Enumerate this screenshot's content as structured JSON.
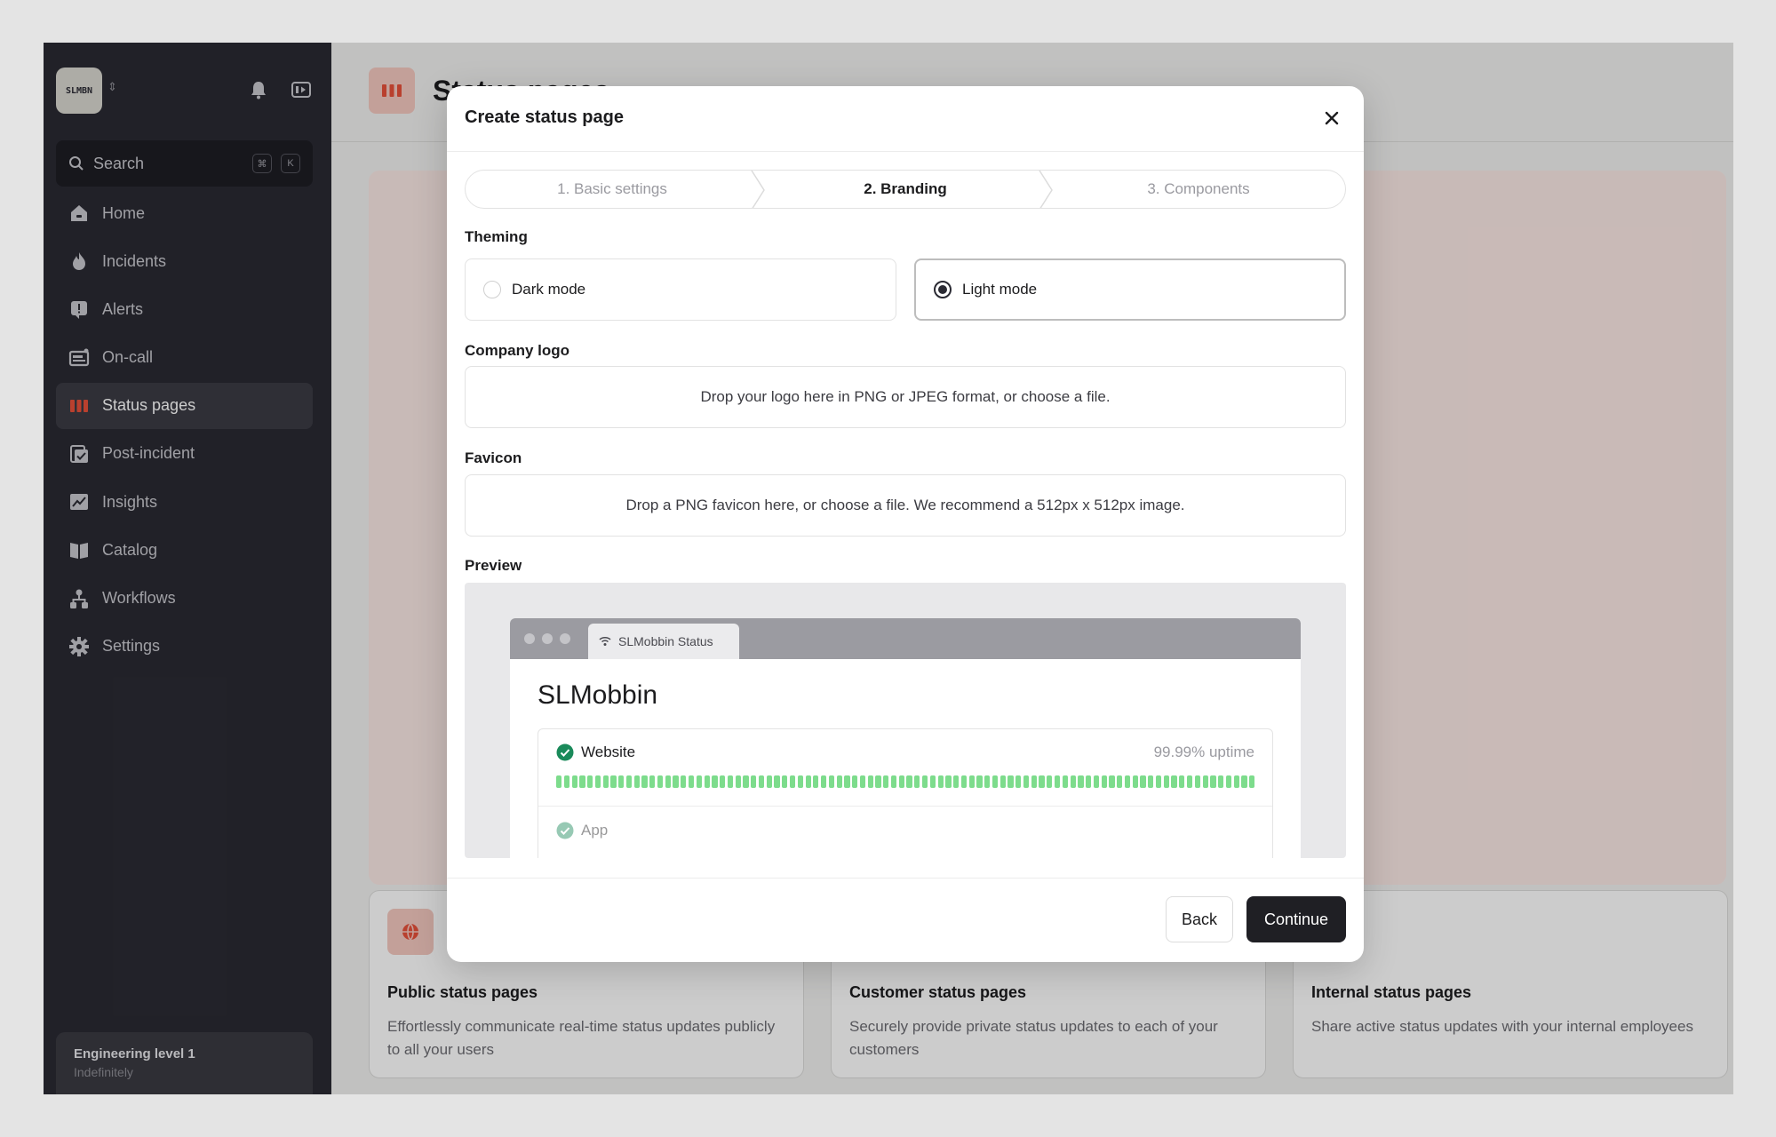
{
  "sidebar": {
    "logo_text": "SLMBN",
    "search": {
      "label": "Search",
      "shortcut_keys": [
        "⌘",
        "K"
      ]
    },
    "items": [
      {
        "label": "Home",
        "icon": "home-icon"
      },
      {
        "label": "Incidents",
        "icon": "flame-icon"
      },
      {
        "label": "Alerts",
        "icon": "alert-icon"
      },
      {
        "label": "On-call",
        "icon": "pager-icon"
      },
      {
        "label": "Status pages",
        "icon": "status-bars-icon",
        "active": true
      },
      {
        "label": "Post-incident",
        "icon": "clipboard-check-icon"
      },
      {
        "label": "Insights",
        "icon": "chart-icon"
      },
      {
        "label": "Catalog",
        "icon": "book-icon"
      },
      {
        "label": "Workflows",
        "icon": "workflow-icon"
      },
      {
        "label": "Settings",
        "icon": "gear-icon"
      }
    ],
    "footer": {
      "title": "Engineering level 1",
      "subtitle": "Indefinitely"
    }
  },
  "main": {
    "title": "Status pages",
    "cards": [
      {
        "title": "Public status pages",
        "description": "Effortlessly communicate real-time status updates publicly to all your users"
      },
      {
        "title": "Customer status pages",
        "description": "Securely provide private status updates to each of your customers"
      },
      {
        "title": "Internal status pages",
        "description": "Share active status updates with your internal employees"
      }
    ]
  },
  "modal": {
    "title": "Create status page",
    "steps": [
      {
        "label": "1. Basic settings",
        "current": false
      },
      {
        "label": "2. Branding",
        "current": true
      },
      {
        "label": "3. Components",
        "current": false
      }
    ],
    "theming": {
      "label": "Theming",
      "options": [
        {
          "label": "Dark mode",
          "selected": false
        },
        {
          "label": "Light mode",
          "selected": true
        }
      ]
    },
    "company_logo": {
      "label": "Company logo",
      "dropzone_text": "Drop your logo here in PNG or JPEG format, or choose a file."
    },
    "favicon": {
      "label": "Favicon",
      "dropzone_text": "Drop a PNG favicon here, or choose a file. We recommend a 512px x 512px image."
    },
    "preview": {
      "label": "Preview",
      "tab_title": "SLMobbin Status",
      "page_title": "SLMobbin",
      "components": [
        {
          "name": "Website",
          "uptime": "99.99% uptime"
        },
        {
          "name": "App"
        }
      ]
    },
    "footer": {
      "back_label": "Back",
      "continue_label": "Continue"
    }
  },
  "colors": {
    "sidebar_bg": "#2a2a33",
    "accent": "#e8503a",
    "uptime_green": "#7ddc8c",
    "check_green": "#1a8a5a",
    "primary_button": "#1f1f24"
  }
}
